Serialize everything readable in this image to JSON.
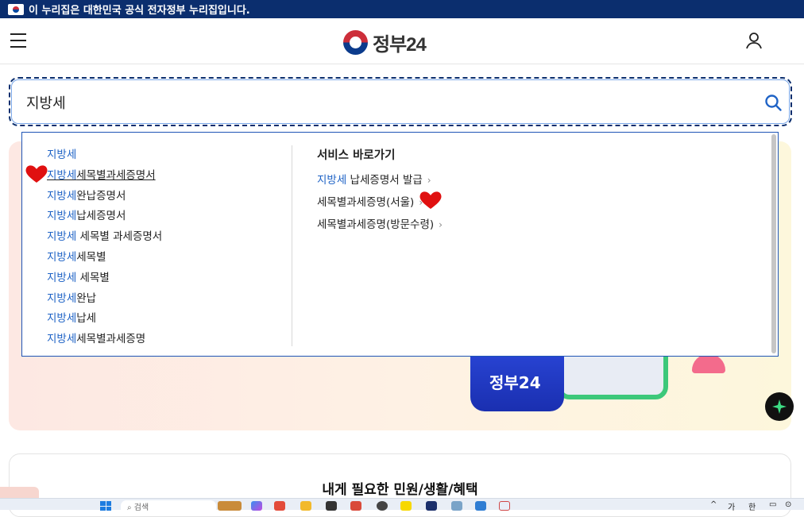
{
  "gov_banner": {
    "text": "이 누리집은 대한민국 공식 전자정부 누리집입니다."
  },
  "header": {
    "logo_text": "정부24"
  },
  "search": {
    "value": "지방세"
  },
  "suggestions": [
    {
      "highlight": "지방세",
      "rest": ""
    },
    {
      "highlight": "지방세",
      "rest": "세목별과세증명서"
    },
    {
      "highlight": "지방세",
      "rest": "완납증명서"
    },
    {
      "highlight": "지방세",
      "rest": "납세증명서"
    },
    {
      "highlight": "지방세",
      "rest": " 세목별 과세증명서"
    },
    {
      "highlight": "지방세",
      "rest": "세목별"
    },
    {
      "highlight": "지방세",
      "rest": " 세목별"
    },
    {
      "highlight": "지방세",
      "rest": "완납"
    },
    {
      "highlight": "지방세",
      "rest": "납세"
    },
    {
      "highlight": "지방세",
      "rest": "세목별과세증명"
    }
  ],
  "quick_links": {
    "title": "서비스 바로가기",
    "items": [
      {
        "highlight": "지방세",
        "rest": " 납세증명서 발급"
      },
      {
        "highlight": "",
        "rest": "세목별과세증명(서울)"
      },
      {
        "highlight": "",
        "rest": "세목별과세증명(방문수령)"
      }
    ],
    "chevron": "›"
  },
  "banner": {
    "app_text": "정부24"
  },
  "section": {
    "title": "내게 필요한 민원/생활/혜택"
  },
  "taskbar": {
    "search_placeholder": "검색",
    "ime_lang": "가",
    "ime_mode": "한"
  },
  "colors": {
    "gov_bar": "#0b2e6e",
    "highlight": "#1f63c6",
    "focus_border": "#0b2e6e",
    "heart_mark": "#e01010"
  },
  "icons": [
    "hamburger-menu-icon",
    "user-icon",
    "search-icon",
    "chevron-right-icon",
    "heart-mark-icon",
    "ai-sparkle-icon",
    "windows-start-icon"
  ]
}
